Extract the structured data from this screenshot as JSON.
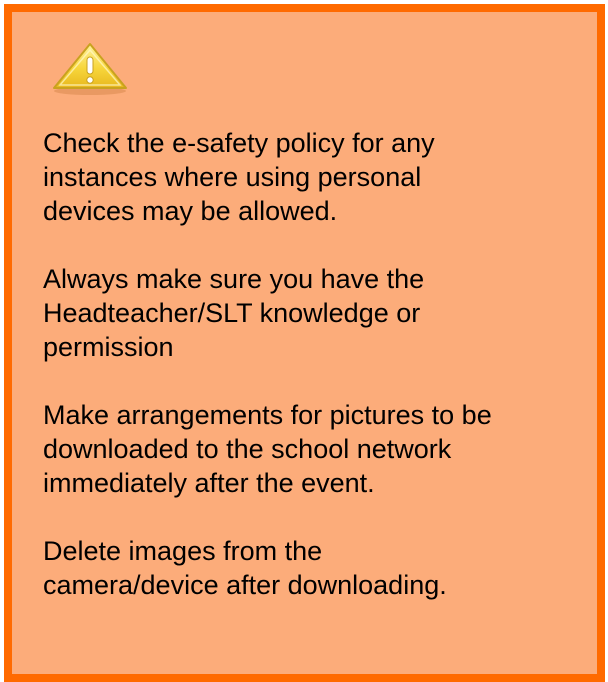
{
  "notice": {
    "icon": "warning-triangle-icon",
    "colors": {
      "background": "#fcac7a",
      "border": "#ff6a00",
      "icon_fill": "#f7d63b",
      "icon_outline": "#c9a21f"
    },
    "paragraphs": [
      "Check the e-safety policy for any\ninstances where using personal\ndevices may be allowed.",
      "Always make sure you have the\nHeadteacher/SLT knowledge or\npermission",
      "Make arrangements for pictures to be\ndownloaded to the school network\nimmediately after the event.",
      "Delete images from the\ncamera/device after downloading."
    ]
  }
}
